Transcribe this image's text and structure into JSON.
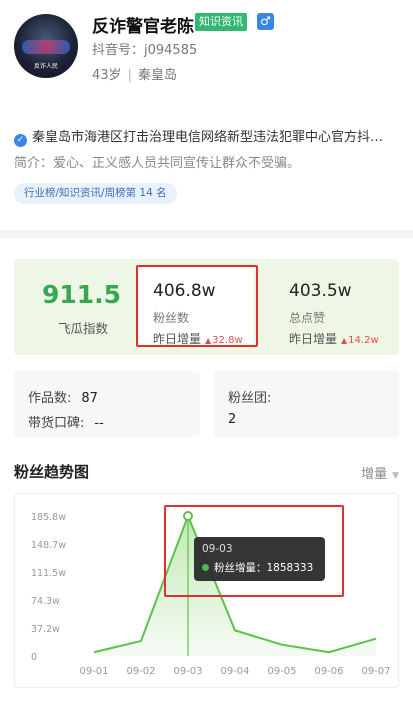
{
  "profile": {
    "name": "反诈警官老陈",
    "category_tag": "知识资讯",
    "gender_icon": "male-symbol-icon",
    "gender_glyph": "♂",
    "douyin_id": "抖音号：j094585",
    "age": "43岁",
    "location": "秦皇岛",
    "verified_text": "秦皇岛市海港区打击治理电信网络新型违法犯罪中心官方抖…",
    "intro": "简介：爱心、正义感人员共同宣传让群众不受骗。",
    "rank": "行业榜/知识资讯/周榜第 14 名",
    "avatar_caption": "反诈人民"
  },
  "stats": {
    "feigua_index": {
      "value": "911.5",
      "label": "飞瓜指数"
    },
    "fans": {
      "value": "406.8w",
      "label": "粉丝数",
      "inc_label": "昨日增量",
      "inc_value": "32.8w",
      "arrow": "▲"
    },
    "likes": {
      "value": "403.5w",
      "label": "总点赞",
      "inc_label": "昨日增量",
      "inc_value": "14.2w",
      "arrow": "▲"
    }
  },
  "counts": {
    "works_label": "作品数:",
    "works_value": "87",
    "reputation_label": "带货口碑:",
    "reputation_value": "--",
    "fan_group_label": "粉丝团:",
    "fan_group_value": "2"
  },
  "trend": {
    "title": "粉丝趋势图",
    "mode": "增量",
    "caret": "▼"
  },
  "chart_data": {
    "type": "area",
    "categories": [
      "09-01",
      "09-02",
      "09-03",
      "09-04",
      "09-05",
      "09-06",
      "09-07"
    ],
    "y_tick_labels": [
      "0",
      "37.2w",
      "74.3w",
      "111.5w",
      "148.7w",
      "185.8w"
    ],
    "ylim": [
      0,
      1858333
    ],
    "series": [
      {
        "values": [
          50000,
          200000,
          1858333,
          340000,
          150000,
          50000,
          230000
        ]
      }
    ],
    "colors": {
      "line": "#5cc24a",
      "fill": "#bfe8b1"
    },
    "tooltip": {
      "date": "09-03",
      "label": "粉丝增量：",
      "value": "1858333"
    }
  },
  "colors": {
    "accent_green": "#36a852",
    "highlight_red": "#e03030",
    "increase_red": "#e05050"
  }
}
